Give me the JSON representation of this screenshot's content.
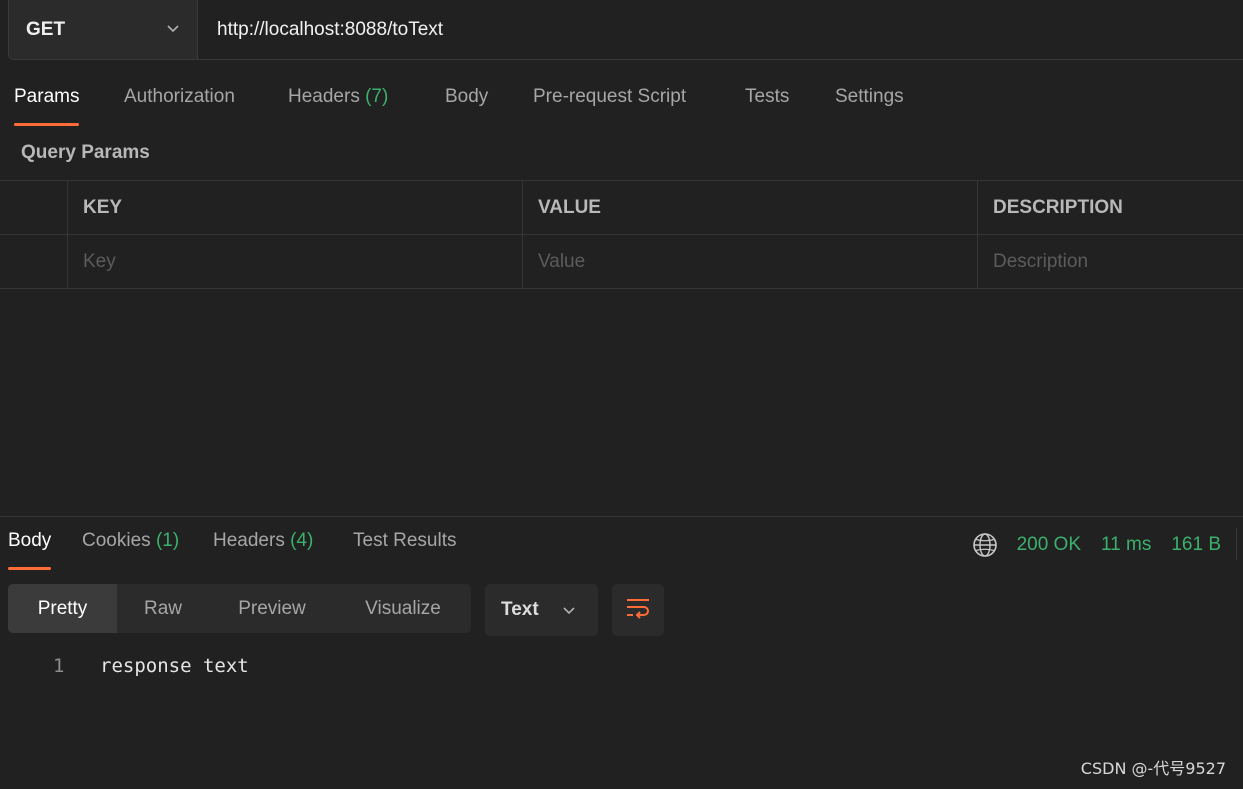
{
  "request": {
    "method": "GET",
    "url": "http://localhost:8088/toText"
  },
  "request_tabs": [
    {
      "label": "Params",
      "active": true
    },
    {
      "label": "Authorization"
    },
    {
      "label": "Headers",
      "count": "(7)"
    },
    {
      "label": "Body"
    },
    {
      "label": "Pre-request Script"
    },
    {
      "label": "Tests"
    },
    {
      "label": "Settings"
    }
  ],
  "query_params": {
    "title": "Query Params",
    "columns": [
      "KEY",
      "VALUE",
      "DESCRIPTION"
    ],
    "placeholders": {
      "key": "Key",
      "value": "Value",
      "description": "Description"
    }
  },
  "response_tabs": [
    {
      "label": "Body",
      "active": true
    },
    {
      "label": "Cookies",
      "count": "(1)"
    },
    {
      "label": "Headers",
      "count": "(4)"
    },
    {
      "label": "Test Results"
    }
  ],
  "response_status": {
    "status": "200 OK",
    "time": "11 ms",
    "size": "161 B",
    "color": "#3bb16d"
  },
  "view_modes": [
    "Pretty",
    "Raw",
    "Preview",
    "Visualize"
  ],
  "format": "Text",
  "body_lines": [
    {
      "number": "1",
      "text": "response text"
    }
  ],
  "watermark": "CSDN @-代号9527",
  "icons": {
    "method_dropdown": "chevron-down-icon",
    "globe": "globe-icon",
    "format_dropdown": "chevron-down-icon",
    "wrap": "wrap-lines-icon"
  },
  "colors": {
    "accent": "#ff6c37",
    "success": "#3bb16d",
    "background": "#212121"
  }
}
